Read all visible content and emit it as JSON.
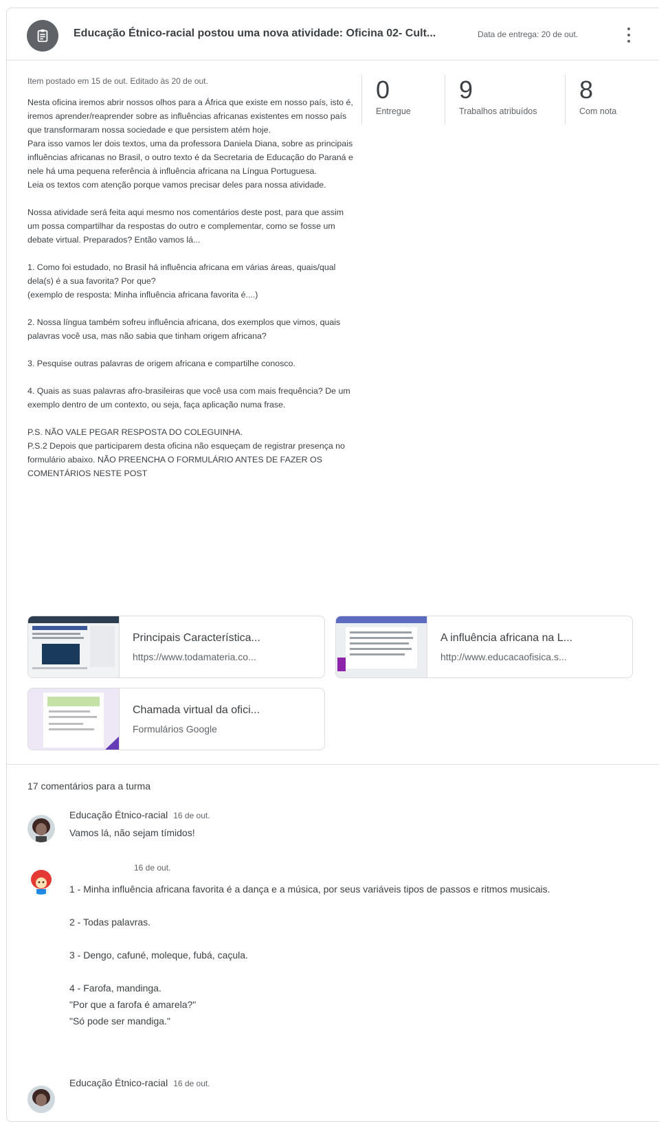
{
  "header": {
    "title": "Educação Étnico-racial postou uma nova atividade: Oficina 02- Cult...",
    "due": "Data de entrega: 20 de out.",
    "icon": "assignment-icon"
  },
  "meta": "Item postado em 15 de out. Editado às 20 de out.",
  "description": [
    "Nesta oficina iremos abrir nossos olhos para a África que existe em nosso país, isto é, iremos aprender/reaprender sobre as influências africanas existentes em nosso país que transformaram nossa sociedade e que persistem atém hoje.\nPara isso vamos ler dois textos, uma da professora Daniela Diana, sobre as principais influências africanas no Brasil, o outro texto é da Secretaria de Educação do Paraná e nele há uma pequena referência à influência africana na Língua Portuguesa.\nLeia os textos com atenção porque vamos precisar deles para nossa atividade.",
    "Nossa atividade será feita aqui mesmo nos comentários deste post, para que assim um possa compartilhar da respostas do outro e complementar, como se fosse um debate virtual. Preparados? Então vamos lá...",
    "1.   Como foi estudado, no Brasil há influência africana em várias áreas, quais/qual dela(s) é a sua favorita? Por que?\n(exemplo de resposta: Minha influência africana favorita é....)",
    "2.   Nossa língua também sofreu influência africana, dos exemplos que vimos, quais palavras você usa, mas não sabia que tinham origem africana?",
    "3.   Pesquise outras palavras de origem africana e compartilhe conosco.",
    "4.   Quais as suas palavras afro-brasileiras que você usa com mais frequência? De um exemplo dentro de um contexto, ou seja, faça aplicação numa frase.",
    "P.S. NÃO VALE PEGAR RESPOSTA DO COLEGUINHA.\nP.S.2 Depois que participarem desta oficina não esqueçam de registrar presença no formulário abaixo. NÃO PREENCHA O FORMULÁRIO ANTES DE FAZER OS COMENTÁRIOS NESTE POST"
  ],
  "stats": [
    {
      "num": "0",
      "label": "Entregue"
    },
    {
      "num": "9",
      "label": "Trabalhos atribuídos"
    },
    {
      "num": "8",
      "label": "Com nota"
    }
  ],
  "attachments": [
    {
      "title": "Principais Característica...",
      "sub": "https://www.todamateria.co..."
    },
    {
      "title": "A influência africana na L...",
      "sub": "http://www.educacaofisica.s..."
    },
    {
      "title": "Chamada virtual da ofici...",
      "sub": "Formulários Google"
    }
  ],
  "comments_count": "17 comentários para a turma",
  "comments": [
    {
      "author": "Educação Étnico-racial",
      "date": "16 de out.",
      "text": "Vamos lá, não sejam tímidos!"
    },
    {
      "author": "",
      "date": "16 de out.",
      "paras": [
        "1 - Minha influência africana favorita é a dança e a música, por seus variáveis tipos de passos e ritmos musicais.",
        "2 - Todas palavras.",
        "3 - Dengo, cafuné, moleque, fubá, caçula.",
        "4 - Farofa, mandinga.\n\"Por que a farofa é amarela?\"\n\"Só pode ser mandiga.\""
      ]
    },
    {
      "author": "Educação Étnico-racial",
      "date": "16 de out."
    }
  ]
}
